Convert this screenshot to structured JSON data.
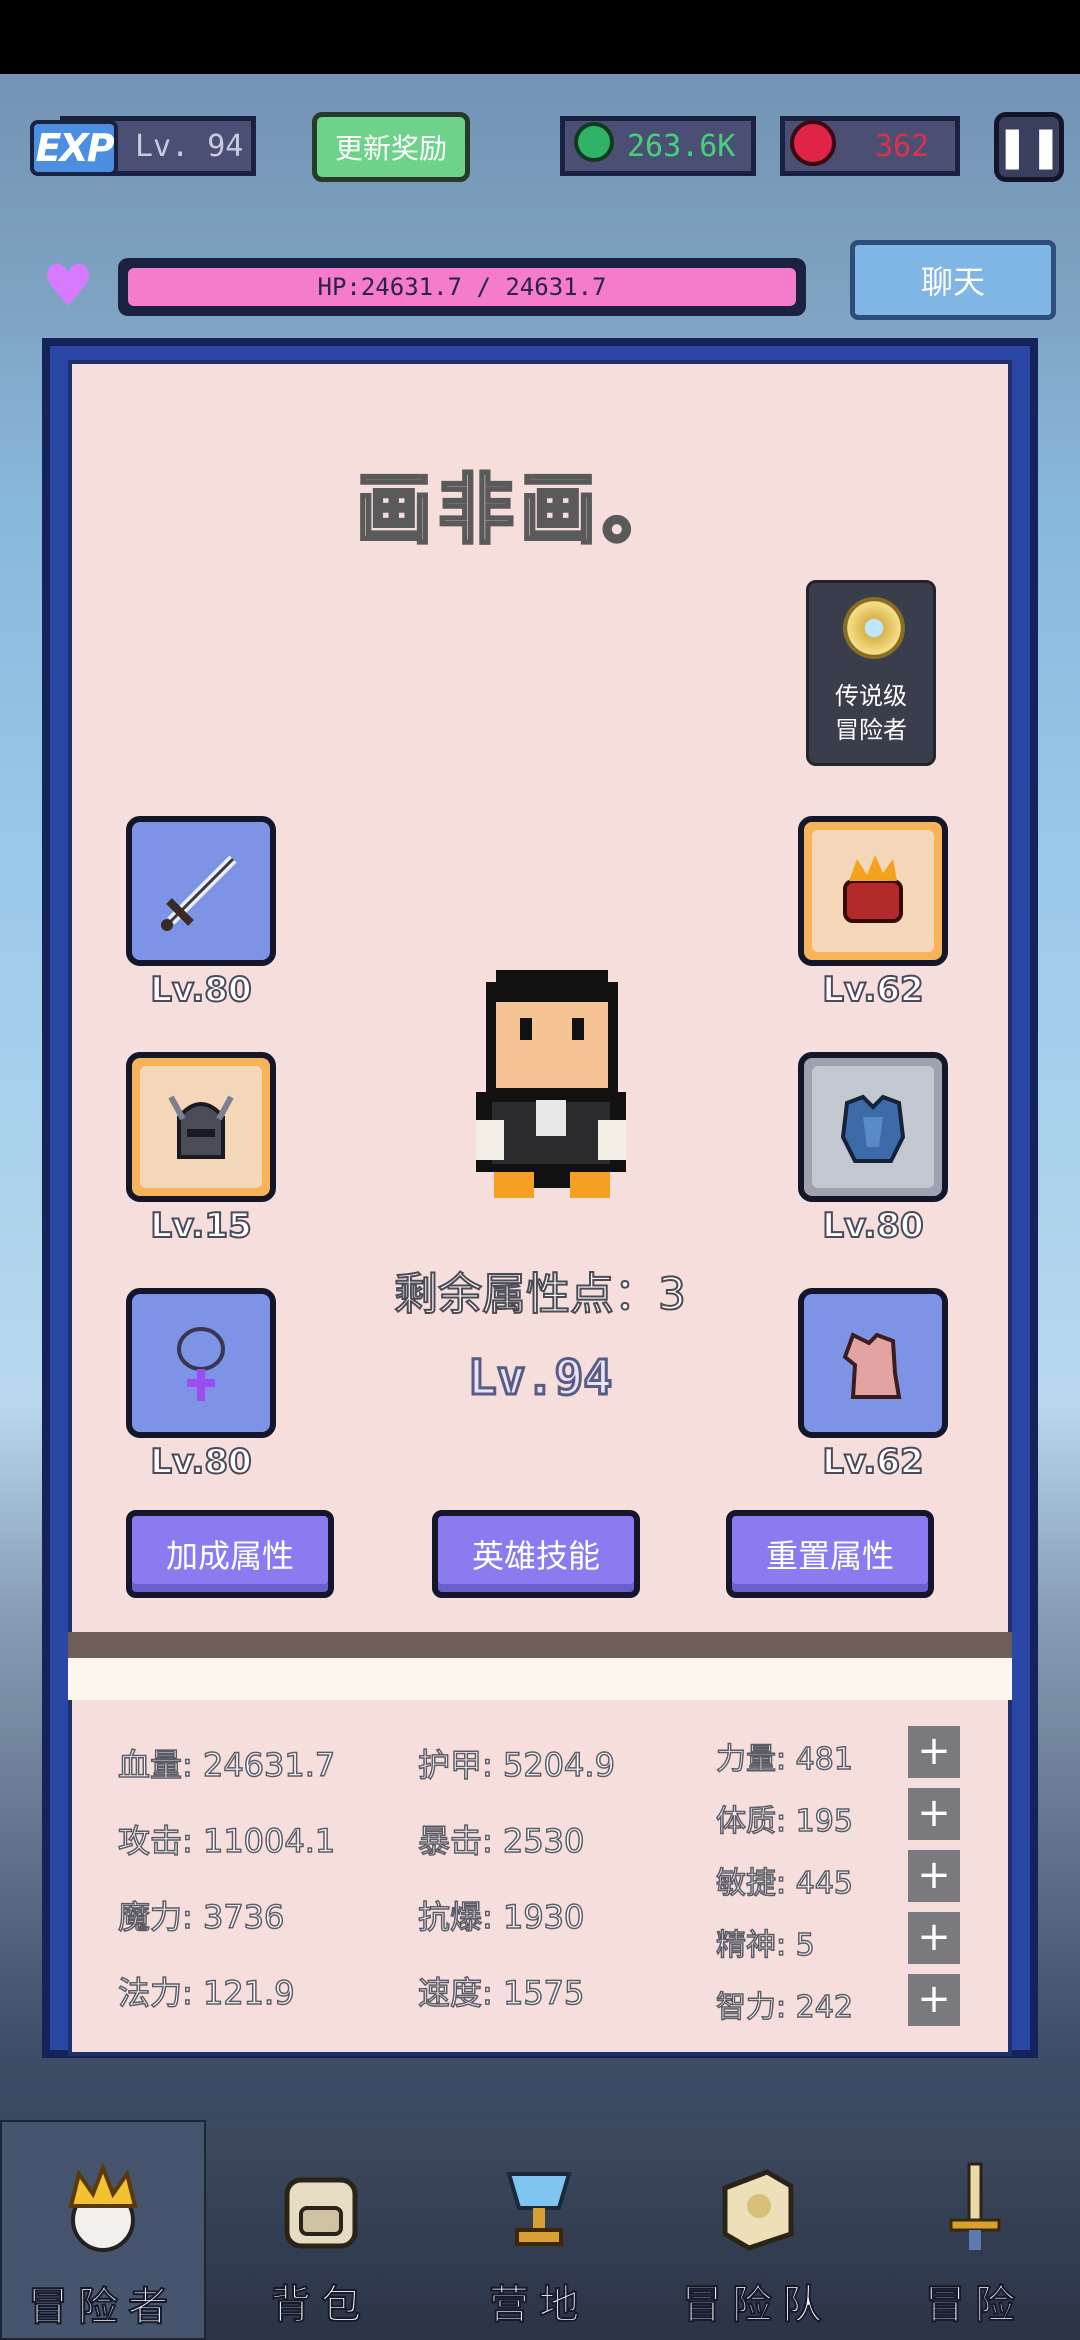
{
  "top": {
    "exp_logo": "EXP",
    "level": "Lv. 94",
    "reward_button": "更新奖励",
    "gems": "263.6K",
    "rubies": "362",
    "pause_icon": "pause-icon"
  },
  "hp": {
    "text": "HP:24631.7 / 24631.7",
    "fraction": 1.0
  },
  "chat_button": "聊天",
  "hero": {
    "name": "画非画。",
    "legend_line1": "传说级",
    "legend_line2": "冒险者",
    "remaining_points": "剩余属性点：3",
    "level": "Lv.94"
  },
  "equipment": {
    "left": [
      {
        "name": "sword",
        "level": "Lv.80",
        "rarity": "blue"
      },
      {
        "name": "helmet",
        "level": "Lv.15",
        "rarity": "orange"
      },
      {
        "name": "necklace",
        "level": "Lv.80",
        "rarity": "blue"
      }
    ],
    "right": [
      {
        "name": "gauntlet",
        "level": "Lv.62",
        "rarity": "orange"
      },
      {
        "name": "armor",
        "level": "Lv.80",
        "rarity": "gray"
      },
      {
        "name": "tunic",
        "level": "Lv.62",
        "rarity": "blue"
      }
    ]
  },
  "actions": {
    "bonus": "加成属性",
    "skills": "英雄技能",
    "reset": "重置属性"
  },
  "stats": {
    "col1": [
      "血量: 24631.7",
      "攻击: 11004.1",
      "魔力: 3736",
      "法力: 121.9"
    ],
    "col2": [
      "护甲: 5204.9",
      "暴击: 2530",
      "抗爆: 1930",
      "速度: 1575"
    ]
  },
  "attributes": [
    {
      "label": "力量: 481"
    },
    {
      "label": "体质: 195"
    },
    {
      "label": "敏捷: 445"
    },
    {
      "label": "精神: 5"
    },
    {
      "label": "智力: 242"
    }
  ],
  "plus_label": "+",
  "nav": [
    {
      "label": "冒险者",
      "icon": "crown-icon",
      "active": true
    },
    {
      "label": "背包",
      "icon": "backpack-icon",
      "active": false
    },
    {
      "label": "营地",
      "icon": "trophy-icon",
      "active": false
    },
    {
      "label": "冒险队",
      "icon": "book-icon",
      "active": false
    },
    {
      "label": "冒险",
      "icon": "sword-icon",
      "active": false
    }
  ]
}
